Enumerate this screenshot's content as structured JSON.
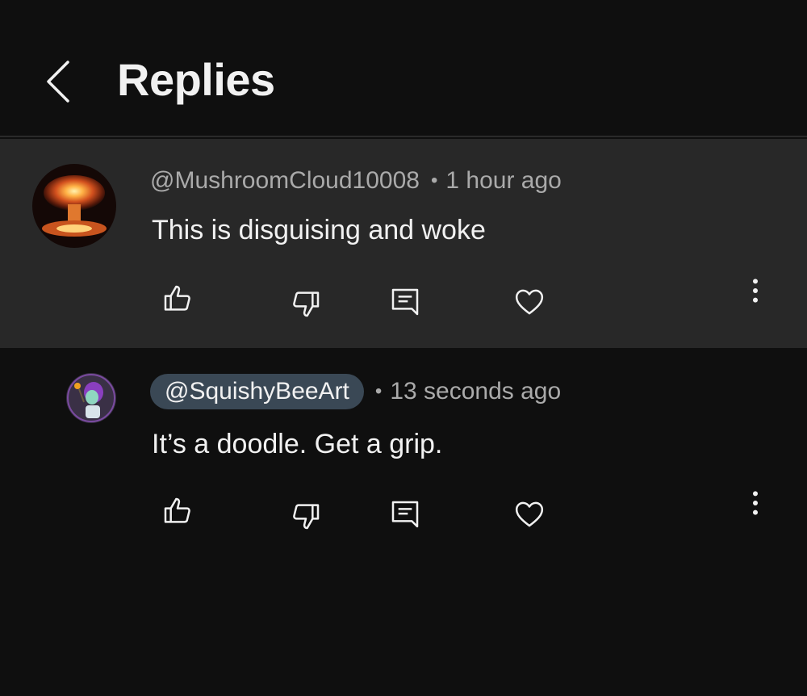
{
  "header": {
    "title": "Replies",
    "back_icon": "chevron-left-icon"
  },
  "comments": [
    {
      "handle": "@MushroomCloud10008",
      "time": "1 hour ago",
      "text": "This is disguising and woke",
      "avatar": "mushroom-cloud-avatar",
      "highlighted_handle": false
    },
    {
      "handle": "@SquishyBeeArt",
      "time": "13 seconds ago",
      "text": "It’s a doodle. Get a grip.",
      "avatar": "cartoon-character-avatar",
      "highlighted_handle": true
    }
  ],
  "separator": "•",
  "icons": {
    "like": "thumbs-up-icon",
    "dislike": "thumbs-down-icon",
    "reply": "reply-comment-icon",
    "heart": "heart-icon",
    "more": "more-vertical-icon"
  },
  "colors": {
    "background": "#0f0f0f",
    "parent_background": "#282828",
    "chip": "#3a4855",
    "text": "#f1f1f1",
    "secondary_text": "#aaaaaa"
  }
}
